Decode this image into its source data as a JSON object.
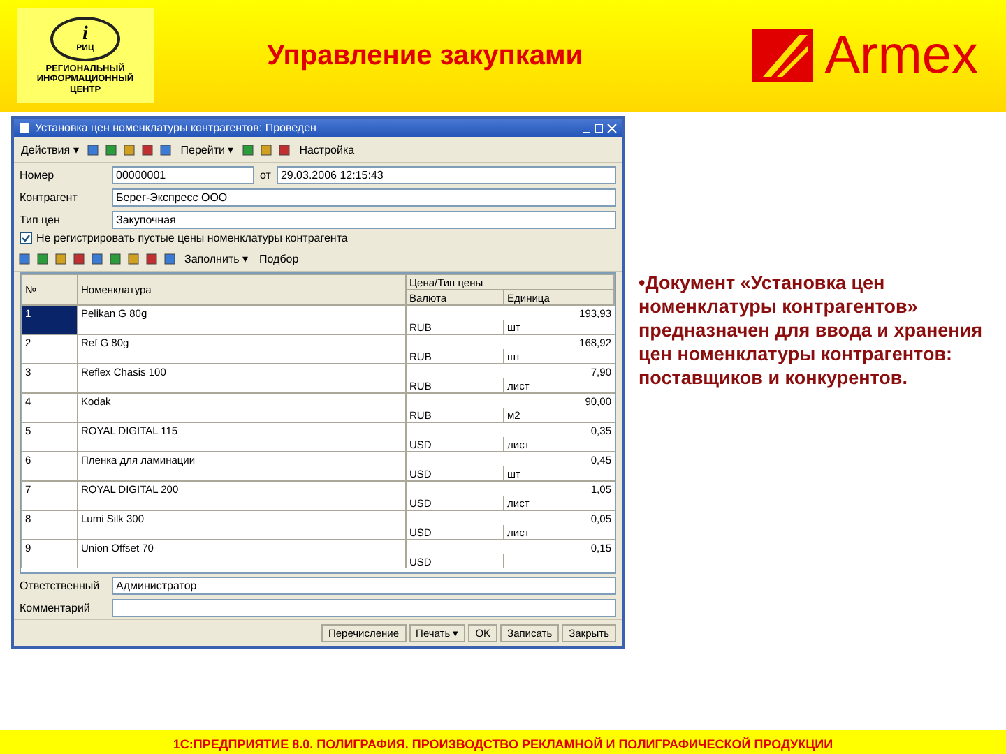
{
  "header": {
    "logo_letter": "i",
    "logo_abbr": "РИЦ",
    "logo_caption": "РЕГИОНАЛЬНЫЙ ИНФОРМАЦИОННЫЙ ЦЕНТР",
    "title": "Управление закупками",
    "brand": "Armex"
  },
  "window": {
    "title": "Установка цен номенклатуры контрагентов: Проведен",
    "toolbar": [
      "Действия ▾",
      "Перейти ▾",
      "Настройка"
    ],
    "fields": [
      {
        "label": "Номер",
        "value": "00000001",
        "extra_label": "от",
        "extra_value": "29.03.2006 12:15:43"
      },
      {
        "label": "Контрагент",
        "value": "Берег-Экспресс ООО"
      },
      {
        "label": "Тип цен",
        "value": "Закупочная"
      }
    ],
    "checkbox": {
      "label": "Не регистрировать пустые цены номенклатуры контрагента",
      "checked": true
    },
    "table_toolbar": [
      "Заполнить ▾",
      "Подбор"
    ],
    "table": {
      "columns": [
        "№",
        "Номенклатура",
        "Цена/Тип цены",
        "Валюта",
        "Единица"
      ],
      "rows": [
        {
          "n": "1",
          "name": "Pelikan G 80g",
          "price": "193,93",
          "currency": "RUB",
          "unit": "шт",
          "selected": true
        },
        {
          "n": "2",
          "name": "Ref G 80g",
          "price": "168,92",
          "currency": "RUB",
          "unit": "шт",
          "selected": false
        },
        {
          "n": "3",
          "name": "Reflex Chasis 100",
          "price": "7,90",
          "currency": "RUB",
          "unit": "лист",
          "selected": false
        },
        {
          "n": "4",
          "name": "Kodak",
          "price": "90,00",
          "currency": "RUB",
          "unit": "м2",
          "selected": false
        },
        {
          "n": "5",
          "name": "ROYAL DIGITAL 115",
          "price": "0,35",
          "currency": "USD",
          "unit": "лист",
          "selected": false
        },
        {
          "n": "6",
          "name": "Пленка для ламинации",
          "price": "0,45",
          "currency": "USD",
          "unit": "шт",
          "selected": false
        },
        {
          "n": "7",
          "name": "ROYAL DIGITAL 200",
          "price": "1,05",
          "currency": "USD",
          "unit": "лист",
          "selected": false
        },
        {
          "n": "8",
          "name": "Lumi Silk 300",
          "price": "0,05",
          "currency": "USD",
          "unit": "лист",
          "selected": false
        },
        {
          "n": "9",
          "name": "Union Offset 70",
          "price": "0,15",
          "currency": "USD",
          "selected": false
        }
      ]
    },
    "bottom_fields": [
      {
        "label": "Ответственный",
        "value": "Администратор"
      },
      {
        "label": "Комментарий"
      }
    ],
    "buttons": [
      "Перечисление",
      "Печать ▾",
      "OK",
      "Записать",
      "Закрыть"
    ]
  },
  "description": "•Документ «Установка цен номенклатуры контрагентов» предназначен для ввода и хранения цен номенклатуры контрагентов: поставщиков и конкурентов.",
  "footer": "1С:ПРЕДПРИЯТИЕ 8.0. ПОЛИГРАФИЯ. ПРОИЗВОДСТВО РЕКЛАМНОЙ И ПОЛИГРАФИЧЕСКОЙ ПРОДУКЦИИ"
}
